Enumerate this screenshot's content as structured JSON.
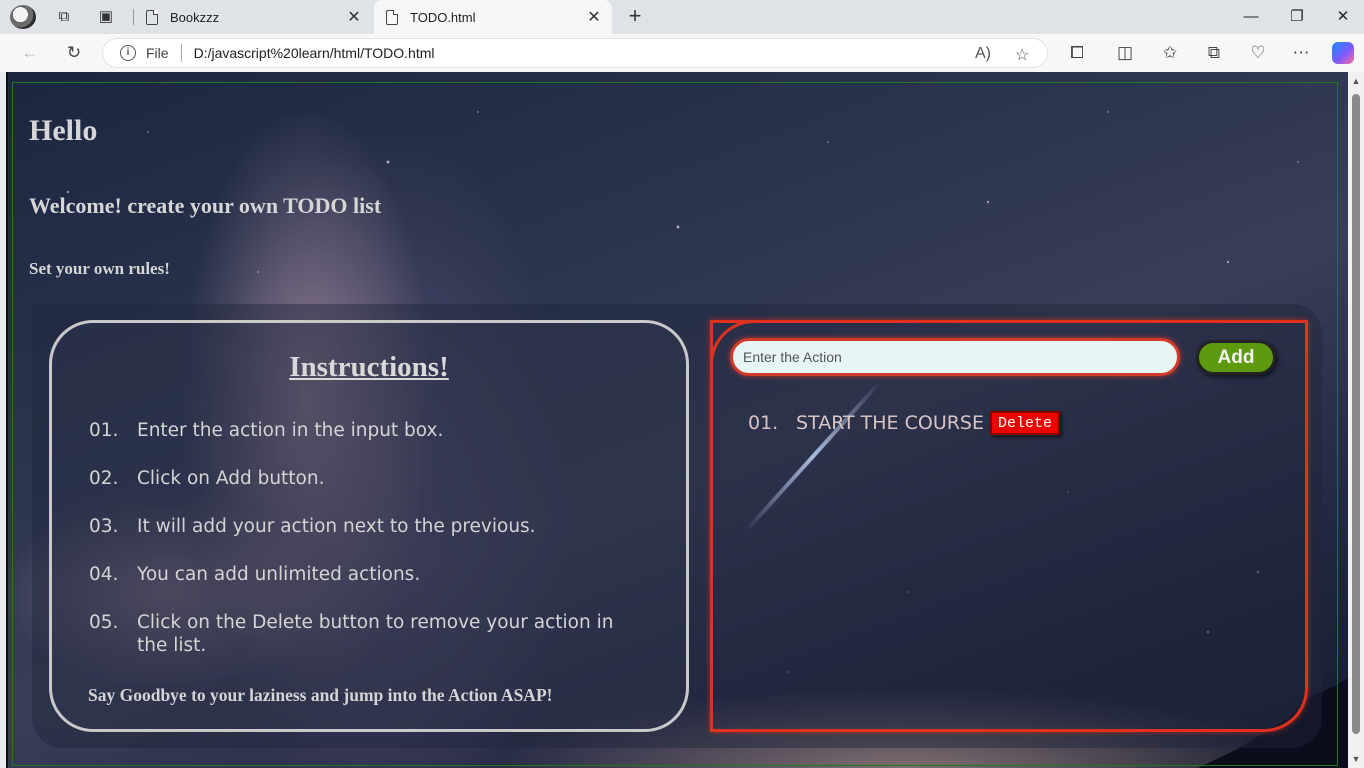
{
  "browser": {
    "tabs": [
      {
        "title": "Bookzzz",
        "active": false
      },
      {
        "title": "TODO.html",
        "active": true
      }
    ],
    "address": {
      "scheme": "File",
      "url": "D:/javascript%20learn/html/TODO.html"
    }
  },
  "page": {
    "heading": "Hello",
    "welcome": "Welcome! create your own TODO list",
    "subheading": "Set your own rules!",
    "instructions": {
      "title": "Instructions!",
      "items": [
        {
          "num": "01.",
          "text": "Enter the action in the input box."
        },
        {
          "num": "02.",
          "text": "Click on Add button."
        },
        {
          "num": "03.",
          "text": "It will add your action next to the previous."
        },
        {
          "num": "04.",
          "text": "You can add unlimited actions."
        },
        {
          "num": "05.",
          "text": "Click on the Delete button to remove your action in the list."
        }
      ],
      "footer": "Say Goodbye to your laziness and jump into the Action ASAP!"
    },
    "todo": {
      "input_placeholder": "Enter the Action",
      "input_value": "",
      "add_label": "Add",
      "items": [
        {
          "num": "01.",
          "text": "START THE COURSE",
          "delete_label": "Delete"
        }
      ]
    }
  },
  "colors": {
    "accent_red": "#e0301e",
    "add_green": "#5e9a10",
    "delete_red": "#ee0000",
    "frame_green": "#1f7a1f"
  }
}
